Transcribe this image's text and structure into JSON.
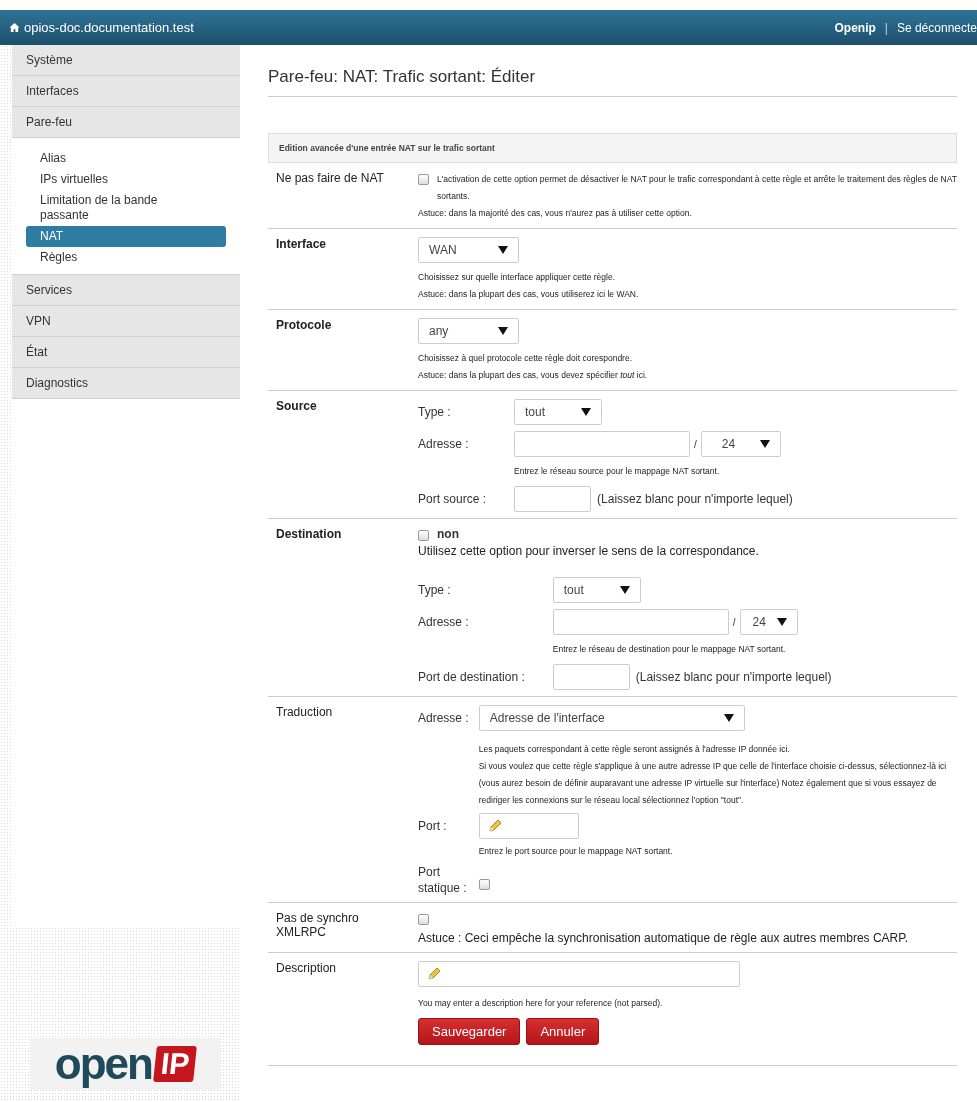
{
  "topbar": {
    "host": "opios-doc.documentation.test",
    "user": "Openip",
    "separator": "|",
    "logout": "Se déconnecte"
  },
  "sidebar": {
    "items": [
      {
        "label": "Système",
        "selected": false
      },
      {
        "label": "Interfaces",
        "selected": false
      },
      {
        "label": "Pare-feu",
        "selected": false,
        "children": [
          {
            "label": "Alias",
            "selected": false
          },
          {
            "label": "IPs virtuelles",
            "selected": false
          },
          {
            "label": "Limitation de la bande passante",
            "selected": false
          },
          {
            "label": "NAT",
            "selected": true
          },
          {
            "label": "Règles",
            "selected": false
          }
        ]
      },
      {
        "label": "Services",
        "selected": false
      },
      {
        "label": "VPN",
        "selected": false
      },
      {
        "label": "État",
        "selected": false
      },
      {
        "label": "Diagnostics",
        "selected": false
      }
    ]
  },
  "page_title": "Pare-feu: NAT: Trafic sortant: Éditer",
  "panel_header": "Edition avancée d'une entrée NAT sur le trafic sortant",
  "rows": [
    {
      "kind": "nonat",
      "label": "Ne pas faire de NAT",
      "emphasized": false,
      "checked": false,
      "text": "L'activation de cette option permet de désactiver le NAT pour le trafic correspondant à cette règle et arrête le traitement des règles de NAT sortants.",
      "hints": [
        "Astuce: dans la majorité des cas, vous n'aurez pas à utiliser cette option."
      ]
    },
    {
      "kind": "select",
      "label": "Interface",
      "emphasized": true,
      "value": "WAN",
      "hints": [
        "Choisissez sur quelle interface appliquer cette règle.",
        "Astuce: dans la plupart des cas, vous utiliserez ici le WAN."
      ]
    },
    {
      "kind": "select",
      "label": "Protocole",
      "emphasized": true,
      "value": "any",
      "hints": [
        "Choisissez à quel protocole cette règle doit corespondre.",
        "Astuce: dans la plupart des cas, vous devez spécifier *tout*  ici."
      ]
    },
    {
      "kind": "endpoint",
      "label": "Source",
      "emphasized": true,
      "type_label": "Type :",
      "type_value": "tout",
      "address_label": "Adresse :",
      "slash": "/",
      "mask": "24",
      "address_hint": "Entrez le réseau source pour le mappage NAT sortant.",
      "port_label": "Port source :",
      "port_note": "(Laissez blanc pour n'importe lequel)"
    },
    {
      "kind": "endpoint",
      "label": "Destination",
      "emphasized": true,
      "invert": {
        "label": "non",
        "checked": false,
        "text": "Utilisez cette option pour inverser le sens de la correspondance."
      },
      "type_label": "Type :",
      "type_value": "tout",
      "address_label": "Adresse :",
      "slash": "/",
      "mask": "24",
      "address_hint": "Entrez le réseau de destination pour le mappage NAT sortant.",
      "port_label": "Port de destination :",
      "port_note": "(Laissez blanc pour n'importe lequel)"
    },
    {
      "kind": "translation",
      "label": "Traduction",
      "emphasized": false,
      "address_label": "Adresse :",
      "address_value": "Adresse de l'interface",
      "hints": [
        "Les paquets correspondant à cette règle seront assignés à l'adresse IP donnée ici.",
        "Si vous voulez que cette règle s'applique à une autre adresse IP que celle de l'interface choisie ci-dessus, sélectionnez-là ici (vous aurez besoin de définir auparavant une adresse IP virtuelle sur l'interface) Notez également que si vous essayez de rediriger les connexions sur le réseau local sélectionnez l'option \"tout\"."
      ],
      "port_label": "Port :",
      "port_hint": "Entrez le port source pour le mappage NAT sortant.",
      "static_label": "Port statique :",
      "static_checked": false
    },
    {
      "kind": "checkbox",
      "label": "Pas de synchro XMLRPC",
      "emphasized": false,
      "checked": false,
      "text": "Astuce : Ceci empêche la synchronisation automatique de règle aux autres membres CARP."
    },
    {
      "kind": "text",
      "label": "Description",
      "emphasized": false,
      "hint": "You may enter a description here for your reference (not parsed)."
    }
  ],
  "buttons": [
    "Sauvegarder",
    "Annuler"
  ],
  "logo": {
    "word": "open",
    "badge": "IP"
  }
}
